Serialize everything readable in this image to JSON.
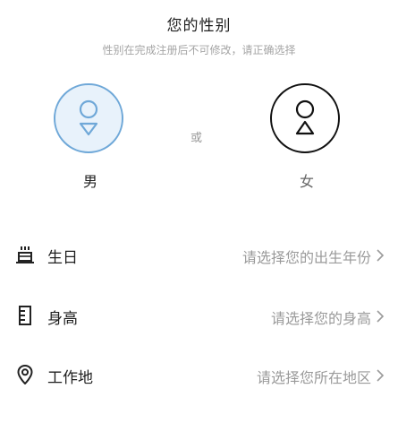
{
  "header": {
    "title": "您的性别",
    "subtitle": "性别在完成注册后不可修改，请正确选择"
  },
  "gender": {
    "selected": "male",
    "male_label": "男",
    "female_label": "女",
    "or_label": "或",
    "male_accent": "#6fa8d8",
    "male_fill": "#e8f2fb",
    "female_accent": "#111111"
  },
  "fields": [
    {
      "label": "生日",
      "placeholder": "请选择您的出生年份",
      "icon": "cake-icon"
    },
    {
      "label": "身高",
      "placeholder": "请选择您的身高",
      "icon": "ruler-icon"
    },
    {
      "label": "工作地",
      "placeholder": "请选择您所在地区",
      "icon": "location-pin-icon"
    }
  ]
}
